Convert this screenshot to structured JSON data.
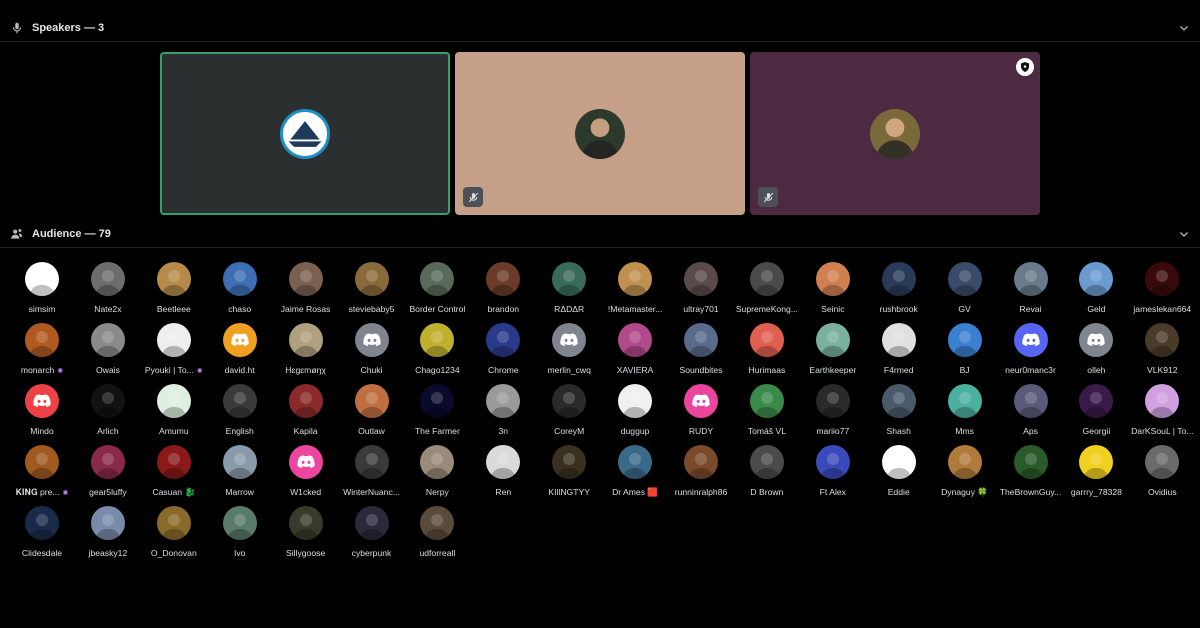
{
  "speakers_section": {
    "title": "Speakers — 3"
  },
  "audience_section": {
    "title": "Audience — 79"
  },
  "speakers": [
    {
      "tile_color": "#2b2f30",
      "speaking": true,
      "muted": false,
      "moderator": false,
      "avatar_color": "#1e8fc3"
    },
    {
      "tile_color": "#c59f88",
      "speaking": false,
      "muted": true,
      "moderator": false,
      "avatar_color": "#2c3a2c"
    },
    {
      "tile_color": "#4b2a42",
      "speaking": false,
      "muted": true,
      "moderator": true,
      "avatar_color": "#7a6a3a"
    }
  ],
  "audience": [
    {
      "name": "simsim",
      "color": "#ffffff"
    },
    {
      "name": "Nate2x",
      "color": "#6d6d6d"
    },
    {
      "name": "Beetleee",
      "color": "#b68a4a"
    },
    {
      "name": "chaso",
      "color": "#3d6fb4"
    },
    {
      "name": "Jaime Rosas",
      "color": "#7a6050"
    },
    {
      "name": "steviebaby5",
      "color": "#8a6a3a"
    },
    {
      "name": "Border Control",
      "color": "#5a6a5a"
    },
    {
      "name": "brandon",
      "color": "#6a3a2a"
    },
    {
      "name": "RΔDΔR",
      "color": "#3a6a5a"
    },
    {
      "name": "!Metamaster...",
      "color": "#c09050"
    },
    {
      "name": "ultray701",
      "color": "#5a4a4a"
    },
    {
      "name": "SupremeKong...",
      "color": "#4a4a4a"
    },
    {
      "name": "Seinic",
      "color": "#d08050"
    },
    {
      "name": "rushbrook",
      "color": "#2a3a5a"
    },
    {
      "name": "GV",
      "color": "#3a4a6a"
    },
    {
      "name": "Revai",
      "color": "#6a7a8a"
    },
    {
      "name": "Geld",
      "color": "#6a9ad0"
    },
    {
      "name": "jameslekan664",
      "color": "#3a0a0a"
    },
    {
      "name": "monarch",
      "color": "#b05a20",
      "badge": "✺"
    },
    {
      "name": "Owais",
      "color": "#8a8a8a"
    },
    {
      "name": "Pyouki | To...",
      "color": "#eeeeee",
      "badge": "✺"
    },
    {
      "name": "david.ht",
      "color": "#f0a020",
      "discord": true
    },
    {
      "name": "Hɛgɛmøŋχ",
      "color": "#b0a080"
    },
    {
      "name": "Chuki",
      "color": "#80848e",
      "discord": true
    },
    {
      "name": "Chago1234",
      "color": "#c0b030"
    },
    {
      "name": "Chrome",
      "color": "#2a3a8a"
    },
    {
      "name": "merlin_cwq",
      "color": "#80848e",
      "discord": true
    },
    {
      "name": "XAVIERA",
      "color": "#b04a8a"
    },
    {
      "name": "Soundbites",
      "color": "#5a6a8a"
    },
    {
      "name": "Hurimaas",
      "color": "#e06050"
    },
    {
      "name": "Earthkeeper",
      "color": "#7ab0a0"
    },
    {
      "name": "F4rmed",
      "color": "#e0e0e0"
    },
    {
      "name": "BJ",
      "color": "#3a80d0"
    },
    {
      "name": "neur0manc3r",
      "color": "#5865f2",
      "discord": true
    },
    {
      "name": "olleh",
      "color": "#80848e",
      "discord": true
    },
    {
      "name": "VLK912",
      "color": "#4a3a2a"
    },
    {
      "name": "Mindo",
      "color": "#ed4245",
      "discord": true
    },
    {
      "name": "Arlich",
      "color": "#111111"
    },
    {
      "name": "Amumu",
      "color": "#e0f0e0"
    },
    {
      "name": "English",
      "color": "#3a3a3a"
    },
    {
      "name": "Kapila",
      "color": "#8a2a2a"
    },
    {
      "name": "Outlaw",
      "color": "#c07040"
    },
    {
      "name": "The Farmer",
      "color": "#0a0a2a"
    },
    {
      "name": "3n",
      "color": "#9a9a9a"
    },
    {
      "name": "CoreyM",
      "color": "#2a2a2a"
    },
    {
      "name": "duggup",
      "color": "#f0f0f0"
    },
    {
      "name": "RUDY",
      "color": "#eb459e",
      "discord": true
    },
    {
      "name": "Tomáš VL",
      "color": "#3a8a4a"
    },
    {
      "name": "mariio77",
      "color": "#2a2a2a"
    },
    {
      "name": "Shash",
      "color": "#4a5a6a"
    },
    {
      "name": "Mms",
      "color": "#4ab0a0"
    },
    {
      "name": "Aps",
      "color": "#5a5a7a"
    },
    {
      "name": "Georgii",
      "color": "#3a1a4a"
    },
    {
      "name": "DarKSouL | To...",
      "color": "#d0a0e0"
    },
    {
      "name": "𝐊𝐈𝐍𝐆 pre...",
      "color": "#a05a20",
      "badge": "✺"
    },
    {
      "name": "gear5luffy",
      "color": "#8a2a4a"
    },
    {
      "name": "Casuan 🐉",
      "color": "#8a1a1a"
    },
    {
      "name": "Marrow",
      "color": "#8a9aaa"
    },
    {
      "name": "W1cked",
      "color": "#eb459e",
      "discord": true
    },
    {
      "name": "WinterNuanc...",
      "color": "#3a3a3a"
    },
    {
      "name": "Nerpy",
      "color": "#9a8a7a"
    },
    {
      "name": "Ren",
      "color": "#dadada"
    },
    {
      "name": "KIllNGTYY",
      "color": "#3a3020"
    },
    {
      "name": "Dr Ames 🟥",
      "color": "#3a6a8a"
    },
    {
      "name": "runninralph86",
      "color": "#7a4a2a"
    },
    {
      "name": "D Brown",
      "color": "#4a4a4a"
    },
    {
      "name": "Ft Alex",
      "color": "#3a4aba"
    },
    {
      "name": "Eddie",
      "color": "#ffffff"
    },
    {
      "name": "Dynaguy 🍀",
      "color": "#b07a3a"
    },
    {
      "name": "TheBrownGuy...",
      "color": "#2a5a2a"
    },
    {
      "name": "garrry_78328",
      "color": "#f0d020"
    },
    {
      "name": "Ovidius",
      "color": "#6a6a6a"
    },
    {
      "name": "Clidesdale",
      "color": "#1a2a4a"
    },
    {
      "name": "jbeasky12",
      "color": "#7a8aaa"
    },
    {
      "name": "O_Donovan",
      "color": "#8a6a2a"
    },
    {
      "name": "Ivo",
      "color": "#5a7a6a"
    },
    {
      "name": "Sillygoose",
      "color": "#3a3a2a"
    },
    {
      "name": "cyberpunk",
      "color": "#2a2a3a"
    },
    {
      "name": "udforreall",
      "color": "#5a4a3a"
    }
  ]
}
